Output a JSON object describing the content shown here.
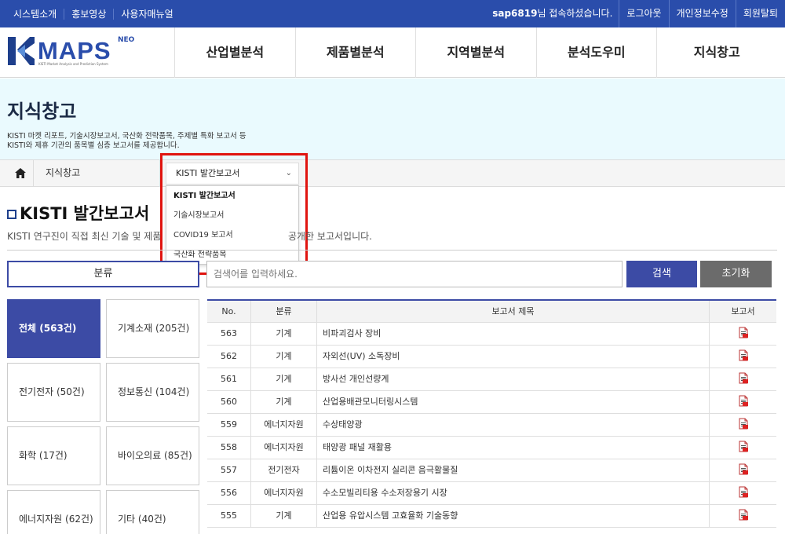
{
  "topbar": {
    "left_links": [
      "시스템소개",
      "홍보영상",
      "사용자매뉴얼"
    ],
    "user_id": "sap6819",
    "welcome_suffix": "님 접속하셨습니다.",
    "right_links": [
      "로그아웃",
      "개인정보수정",
      "회원탈퇴"
    ]
  },
  "logo": {
    "text": "MAPS",
    "badge": "NEO",
    "subtitle": "KISTI Market Analysis and Prediction System"
  },
  "gnb": [
    "산업별분석",
    "제품별분석",
    "지역별분석",
    "분석도우미",
    "지식창고"
  ],
  "hero": {
    "title": "지식창고",
    "desc1": "KISTI 마켓 리포트, 기술시장보고서, 국산화 전략품목, 주제별 특화 보고서 등",
    "desc2": "KISTI와 제휴 기관의 품목별 심층 보고서를 제공합니다."
  },
  "breadcrumb": {
    "level1": "지식창고"
  },
  "dropdown": {
    "selected": "KISTI 발간보고서",
    "options": [
      "KISTI 발간보고서",
      "기술시장보고서",
      "COVID19 보고서",
      "국산화 전략품목"
    ]
  },
  "section": {
    "title": "KISTI 발간보고서",
    "desc_start": "KISTI 연구진이 직접 최신 기술 및 제품",
    "desc_end": "공개한 보고서입니다."
  },
  "filter": {
    "category_label": "분류",
    "search_placeholder": "검색어를 입력하세요.",
    "search_button": "검색",
    "reset_button": "초기화"
  },
  "categories": [
    "전체 (563건)",
    "기계소재 (205건)",
    "전기전자 (50건)",
    "정보통신 (104건)",
    "화학 (17건)",
    "바이오의료 (85건)",
    "에너지자원 (62건)",
    "기타 (40건)"
  ],
  "table": {
    "headers": [
      "No.",
      "분류",
      "보고서 제목",
      "보고서"
    ],
    "rows": [
      {
        "no": "563",
        "cat": "기계",
        "title": "비파괴검사 장비"
      },
      {
        "no": "562",
        "cat": "기계",
        "title": "자외선(UV) 소독장비"
      },
      {
        "no": "561",
        "cat": "기계",
        "title": "방사선 개인선량계"
      },
      {
        "no": "560",
        "cat": "기계",
        "title": "산업용배관모니터링시스템"
      },
      {
        "no": "559",
        "cat": "에너지자원",
        "title": "수상태양광"
      },
      {
        "no": "558",
        "cat": "에너지자원",
        "title": "태양광 패널 재활용"
      },
      {
        "no": "557",
        "cat": "전기전자",
        "title": "리튬이온 이차전지 실리콘 음극활물질"
      },
      {
        "no": "556",
        "cat": "에너지자원",
        "title": "수소모빌리티용 수소저장용기 시장"
      },
      {
        "no": "555",
        "cat": "기계",
        "title": "산업용 유압시스템 고효율화 기술동향"
      }
    ]
  }
}
